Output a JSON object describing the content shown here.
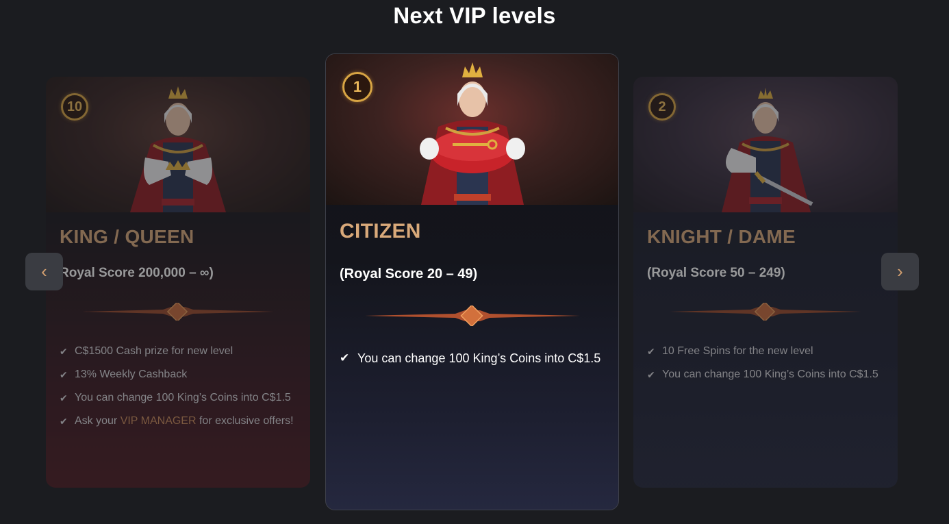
{
  "page": {
    "title": "Next VIP levels"
  },
  "navigation": {
    "prev_icon": "chevron-left",
    "next_icon": "chevron-right",
    "prev_glyph": "‹",
    "next_glyph": "›"
  },
  "cards": [
    {
      "level": "10",
      "title": "KING / QUEEN",
      "score": "Royal Score 200,000 – ∞)",
      "benefits": [
        "C$1500 Cash prize for new level",
        "13% Weekly Cashback",
        "You can change 100 King’s Coins into C$1.5"
      ],
      "vip_line": {
        "before": "Ask your ",
        "highlight": "VIP MANAGER",
        "after": " for exclusive offers!"
      }
    },
    {
      "level": "1",
      "title": "CITIZEN",
      "score": "(Royal Score 20 – 49)",
      "benefits": [
        "You can change 100 King’s Coins into C$1.5"
      ]
    },
    {
      "level": "2",
      "title": "KNIGHT / DAME",
      "score": "(Royal Score 50 – 249)",
      "benefits": [
        "10 Free Spins for the new level",
        "You can change 100 King’s Coins into C$1.5"
      ]
    }
  ],
  "colors": {
    "background": "#1b1c20",
    "title_gold": "#d9a97a",
    "badge_gold": "#d8a544",
    "highlight": "#c88a5a",
    "king_red": "#a8252b"
  },
  "check_glyph": "✔"
}
